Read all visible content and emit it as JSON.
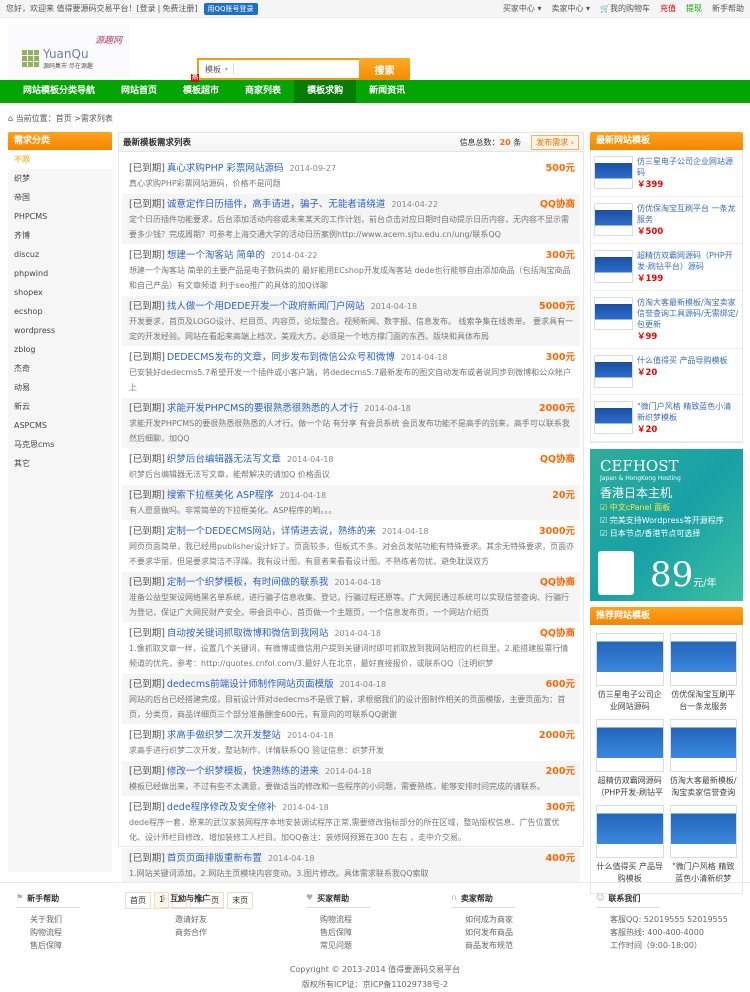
{
  "topbar": {
    "welcome": "您好，欢迎来 值得要源码交易平台！[",
    "login": "登录",
    "sep": "|",
    "register": "免费注册",
    "close": "]",
    "qq_login": "用QQ账号登录",
    "links": [
      "买家中心 ▾",
      "卖家中心 ▾",
      "我的购物车",
      "充值",
      "提现",
      "新手帮助"
    ]
  },
  "logo": {
    "name": "YuanQu",
    "slogan": "源码集市 尽在源趣",
    "signature": "源趣网"
  },
  "search": {
    "category": "模板",
    "arrow": "▾",
    "value": "",
    "button": "搜索"
  },
  "nav": {
    "items": [
      "网站模板分类导航",
      "网站首页",
      "模板超市",
      "商家列表",
      "模板求购",
      "新闻资讯"
    ],
    "hot_badge": "热"
  },
  "breadcrumb": {
    "label": "当前位置：",
    "home": "首页",
    "current": ">需求列表"
  },
  "sidebar": {
    "title": "需求分类",
    "categories": [
      "不限",
      "织梦",
      "帝国",
      "PHPCMS",
      "齐博",
      "discuz",
      "phpwind",
      "shopex",
      "ecshop",
      "wordpress",
      "zblog",
      "杰奇",
      "动易",
      "新云",
      "ASPCMS",
      "马克思cms",
      "其它"
    ]
  },
  "main": {
    "title": "最新模板需求列表",
    "total_label": "信息总数：",
    "total": "20",
    "total_unit": "条",
    "publish": "发布需求 ›",
    "items": [
      {
        "tag": "[已到期]",
        "title": "真心求购PHP 彩票网站源码",
        "date": "2014-09-27",
        "price": "500元",
        "desc": "真心求购PHP彩票网站源码，价格不是问题"
      },
      {
        "tag": "[已到期]",
        "title": "诚意定作日历插件，高手请进，骗子、无能者请绕道",
        "date": "2014-04-22",
        "price": "QQ协商",
        "desc": "定个日历插件功能要求，后台添加活动内容或未来某天的工作计划，前台点击对应日期时自动提示日历内容，无内容不显示需要多少钱？完成周期？可参考上海交通大学的活动日历案例http://www.acem.sjtu.edu.cn/ung/联系QQ"
      },
      {
        "tag": "[已到期]",
        "title": "想建一个淘客站 简单的",
        "date": "2014-04-22",
        "price": "300元",
        "desc": "想建一个淘客站 简单的主要产品是电子数码类的 最好能用ECshop开发成淘客站 dede也行能够自由添加商品（包括淘宝商品和自己产品）有文章频道 利于seo推广的具体的加Q详聊"
      },
      {
        "tag": "[已到期]",
        "title": "找人做一个用DEDE开发一个政府新闻门户网站",
        "date": "2014-04-18",
        "price": "5000元",
        "desc": "开发要求，首页及LOGO设计、栏目页、内容页，论坛整合。视频新闻、数字报、信息发布。 线索争集在线表单。 要求具有一定的开发经验。网站在看起来高端上档次，美观大方。必须是一个地方撑门面的东西。版块和具体布局"
      },
      {
        "tag": "[已到期]",
        "title": "DEDECMS发布的文章，同步发布到微信公众号和微博",
        "date": "2014-04-18",
        "price": "300元",
        "desc": "已安装好dedecms5.7希望开发一个插件或小客户端，将dedecms5.7最新发布的图文自动发布或者说同步到微博和公众帐户上"
      },
      {
        "tag": "[已到期]",
        "title": "求能开发PHPCMS的要很熟悉很熟悉的人才行",
        "date": "2014-04-18",
        "price": "2000元",
        "desc": "求能开发PHPCMS的要很熟悉很熟悉的人才行。做一个站 有分享 有会员系统 会员发布功能不是高手的别来，高手可以联系我 然后细聊，加QQ"
      },
      {
        "tag": "[已到期]",
        "title": "织梦后台编辑器无法写文章",
        "date": "2014-04-18",
        "price": "QQ协商",
        "desc": "织梦后台编辑器无法写文章，能帮解决的请加Q 价格面议"
      },
      {
        "tag": "[已到期]",
        "title": "搜索下拉框美化 ASP程序",
        "date": "2014-04-18",
        "price": "20元",
        "desc": "有人愿意做吗。非常简单的下拉框美化。ASP程序的哟。。。"
      },
      {
        "tag": "[已到期]",
        "title": "定制一个DEDECMS网站，详情进去说，熟练的来",
        "date": "2014-04-18",
        "price": "3000元",
        "desc": "网页页面简单，我已经用publisher设计好了。页面较多，但板式不多。对会员发帖功能有特殊要求。其余无特殊要求，页面亦不要求华丽，但是要求简洁不浮躁。我有设计图，有意者来看看设计图。不熟练者勿扰，避免耽误双方"
      },
      {
        "tag": "[已到期]",
        "title": "定制一个织梦模板，有时间做的联系我",
        "date": "2014-04-18",
        "price": "QQ协商",
        "desc": "准备公益型架设网络黑名单系统，进行骗子信息收集、登记，行骗过程还原等。广大网民通过系统可以实现信誉查询、行骗行为登记，保证广大网民财产安全。带会员中心，首页做一个主题页，一个信息发布页，一个网站介绍页"
      },
      {
        "tag": "[已到期]",
        "title": "自动按关键词抓取微博和微信到我网站",
        "date": "2014-04-18",
        "price": "QQ协商",
        "desc": "1.像抓取文章一样，设置几个关键词，有微博或微信用户提到关键词时即可抓取放到我网站相应的栏目里。2.能搭建股票行情频道的优先，参考：http://quotes.cnfol.com/3.最好人在北京，最好直接报价，或联系QQ（注明织梦"
      },
      {
        "tag": "[已到期]",
        "title": "dedecms前端设计师制作网站页面模版",
        "date": "2014-04-18",
        "price": "600元",
        "desc": "网站的后台已经搭建完成，目前设计师对dedecms不是很了解，求根据我们的设计图制作相关的页面模版，主要页面为：首页，分类页，商品详细页三个部分准备酬金600元，有意向的可联系QQ谢谢"
      },
      {
        "tag": "[已到期]",
        "title": "求高手做织梦二次开发整站",
        "date": "2014-04-18",
        "price": "2000元",
        "desc": "求高手进行织梦二次开发，整站制作，详情联系QQ 验证信息：织梦开发"
      },
      {
        "tag": "[已到期]",
        "title": "修改一个织梦模板，快速熟练的进来",
        "date": "2014-04-18",
        "price": "200元",
        "desc": "模板已经做出来，不过有些不太满意，要做适当的修改和一些程序的小问题，需要熟练，能够安排时间完成的请联系。"
      },
      {
        "tag": "[已到期]",
        "title": "dede程序修改及安全修补",
        "date": "2014-04-18",
        "price": "300元",
        "desc": "dede程序一套，原来的武汉家装网程序本地安装调试程序正常,需要修改指标部分的所在区域，整站版权信息、广告位置优化、设计师栏目修改、增加装修工人栏目。加QQ备注：装修网预算在300 左右 ，走中介交易。"
      },
      {
        "tag": "[已到期]",
        "title": "首页页面排版重新布置",
        "date": "2014-04-18",
        "price": "400元",
        "desc": "1.网站关键词添加。2.网站主页模块内容变动。3.图片修改。具体需求联系我QQ索取"
      }
    ],
    "pager": [
      "首页",
      "1",
      "2",
      "下一页",
      "末页"
    ]
  },
  "latest": {
    "title": "最新网站模板",
    "items": [
      {
        "name": "仿三星电子公司企业网站源码",
        "price": "￥399"
      },
      {
        "name": "仿优保淘宝互刷平台 一条龙服务",
        "price": "￥500"
      },
      {
        "name": "超精仿双霸网源码（PHP开发-刷钻平台）源码",
        "price": "￥199"
      },
      {
        "name": "仿淘大客最新模板/淘宝卖家信誉查询工具源码/无需绑定/包更新",
        "price": "￥99"
      },
      {
        "name": "什么值得买 产品导购模板",
        "price": "￥20"
      },
      {
        "name": "\"微门户风格 精致蓝色小清新织梦模板",
        "price": "￥20"
      }
    ]
  },
  "ad": {
    "brand": "CEFHOST",
    "sub": "Japan & HongKong Hosting",
    "headline": "香港日本主机",
    "features": [
      "中文cPanel 面板",
      "完美支持Wordpress等开源程序",
      "日本节点/香港节点可选择"
    ],
    "price": "89",
    "unit": "元/年"
  },
  "recommend": {
    "title": "推荐网站模板",
    "items": [
      "仿三星电子公司企业网站源码",
      "仿优保淘宝互刷平台一条龙服务",
      "超精仿双霸网源码（PHP开发-刷钻平",
      "仿淘大客最新模板/淘宝卖家信誉查询",
      "什么值得买 产品导购模板",
      "\"微门户风格 精致蓝色小清新织梦"
    ]
  },
  "footer": {
    "cols": [
      {
        "icon": "⚑",
        "title": "新手帮助",
        "links": [
          "关于我们",
          "购物流程",
          "售后保障"
        ]
      },
      {
        "icon": "$",
        "title": "互动与推广",
        "links": [
          "邀请好友",
          "商务合作"
        ]
      },
      {
        "icon": "♥",
        "title": "买家帮助",
        "links": [
          "购物流程",
          "售后保障",
          "常见问题"
        ]
      },
      {
        "icon": "∩",
        "title": "卖家帮助",
        "links": [
          "如何成为商家",
          "如何发布商品",
          "商品发布规范"
        ]
      },
      {
        "icon": "☺",
        "title": "联系我们",
        "links": [
          "客服QQ: 52019555 52019555",
          "客服热线: 400-400-4000",
          "工作时间（9:00-18:00）"
        ]
      }
    ],
    "copyright": "Copyright © 2013-2014 值得要源码交易平台",
    "icp": "版权所有ICP证：京ICP备11029738号-2"
  },
  "colors": {
    "nav_green": "#05a405",
    "accent_orange": "#f58500",
    "price": "#ff6600",
    "link": "#2a64c5"
  }
}
